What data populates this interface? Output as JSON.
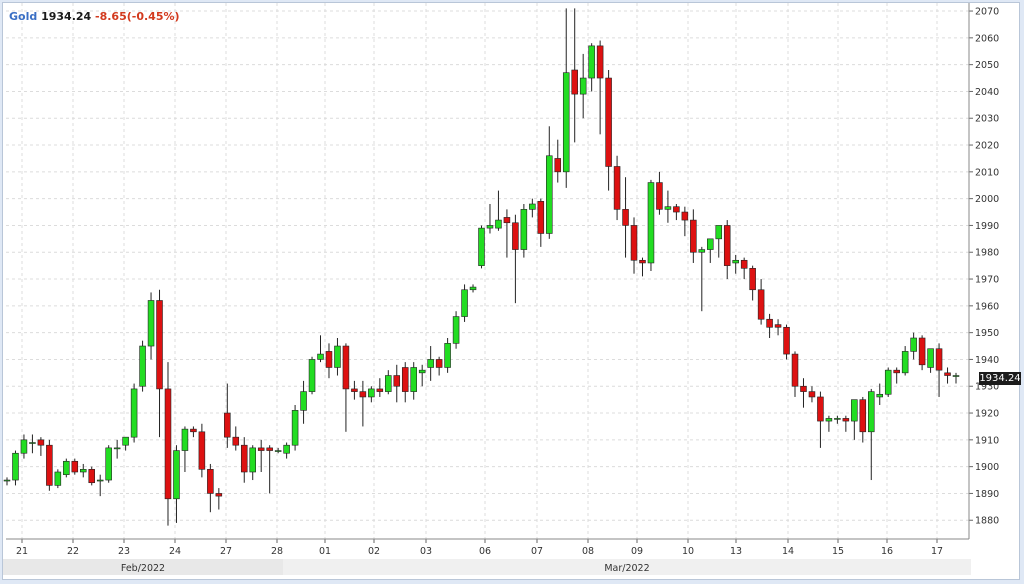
{
  "header": {
    "symbol": "Gold",
    "price": "1934.24",
    "change": "-8.65(-0.45%)"
  },
  "colors": {
    "up": "#22dd22",
    "down": "#dd1111",
    "grid": "#dcdcdc",
    "axis_text": "#333333",
    "background": "#ffffff"
  },
  "chart_data": {
    "type": "candlestick",
    "title": "",
    "xlabel": "",
    "ylabel": "",
    "ylim": [
      1873,
      2073
    ],
    "y_ticks": [
      1880,
      1890,
      1900,
      1910,
      1920,
      1930,
      1940,
      1950,
      1960,
      1970,
      1980,
      1990,
      2000,
      2010,
      2020,
      2030,
      2040,
      2050,
      2060,
      2070
    ],
    "last_price_label": "1934.24",
    "day_labels": [
      "21",
      "22",
      "23",
      "24",
      "27",
      "28",
      "01",
      "02",
      "03",
      "06",
      "07",
      "08",
      "09",
      "10",
      "13",
      "14",
      "15",
      "16",
      "17"
    ],
    "month_labels": [
      "Feb/2022",
      "Mar/2022"
    ],
    "candles": [
      [
        1895,
        1896,
        1893,
        1895
      ],
      [
        1895,
        1906,
        1893,
        1905
      ],
      [
        1905,
        1912,
        1903,
        1910
      ],
      [
        1909,
        1912,
        1905,
        1909
      ],
      [
        1910,
        1911,
        1904,
        1908
      ],
      [
        1908,
        1910,
        1891,
        1893
      ],
      [
        1893,
        1899,
        1892,
        1898
      ],
      [
        1897,
        1903,
        1896,
        1902
      ],
      [
        1902,
        1903,
        1897,
        1898
      ],
      [
        1898,
        1901,
        1896,
        1899
      ],
      [
        1899,
        1900,
        1893,
        1894
      ],
      [
        1895,
        1897,
        1889,
        1895
      ],
      [
        1895,
        1908,
        1894,
        1907
      ],
      [
        1907,
        1910,
        1903,
        1907
      ],
      [
        1908,
        1911,
        1906,
        1911
      ],
      [
        1911,
        1931,
        1909,
        1929
      ],
      [
        1930,
        1947,
        1928,
        1945
      ],
      [
        1945,
        1965,
        1940,
        1962
      ],
      [
        1962,
        1966,
        1911,
        1929
      ],
      [
        1929,
        1939,
        1878,
        1888
      ],
      [
        1888,
        1908,
        1879,
        1906
      ],
      [
        1906,
        1915,
        1898,
        1914
      ],
      [
        1914,
        1915,
        1911,
        1913
      ],
      [
        1913,
        1916,
        1896,
        1899
      ],
      [
        1899,
        1901,
        1883,
        1890
      ],
      [
        1890,
        1892,
        1884,
        1889
      ],
      [
        1920,
        1931,
        1907,
        1911
      ],
      [
        1911,
        1915,
        1906,
        1908
      ],
      [
        1908,
        1911,
        1894,
        1898
      ],
      [
        1898,
        1908,
        1895,
        1907
      ],
      [
        1907,
        1910,
        1898,
        1906
      ],
      [
        1907,
        1908,
        1890,
        1906
      ],
      [
        1906,
        1907,
        1905,
        1906
      ],
      [
        1905,
        1909,
        1903,
        1908
      ],
      [
        1908,
        1923,
        1906,
        1921
      ],
      [
        1921,
        1932,
        1916,
        1928
      ],
      [
        1928,
        1941,
        1927,
        1940
      ],
      [
        1940,
        1949,
        1939,
        1942
      ],
      [
        1943,
        1946,
        1933,
        1937
      ],
      [
        1937,
        1948,
        1934,
        1945
      ],
      [
        1945,
        1946,
        1913,
        1929
      ],
      [
        1929,
        1932,
        1925,
        1928
      ],
      [
        1928,
        1932,
        1915,
        1926
      ],
      [
        1926,
        1930,
        1924,
        1929
      ],
      [
        1929,
        1933,
        1926,
        1928
      ],
      [
        1928,
        1936,
        1927,
        1934
      ],
      [
        1934,
        1938,
        1924,
        1930
      ],
      [
        1937,
        1939,
        1924,
        1928
      ],
      [
        1928,
        1939,
        1925,
        1937
      ],
      [
        1935,
        1938,
        1930,
        1936
      ],
      [
        1937,
        1945,
        1932,
        1940
      ],
      [
        1940,
        1941,
        1934,
        1937
      ],
      [
        1937,
        1948,
        1935,
        1946
      ],
      [
        1946,
        1958,
        1944,
        1956
      ],
      [
        1956,
        1968,
        1954,
        1966
      ],
      [
        1966,
        1968,
        1965,
        1967
      ],
      [
        1975,
        1990,
        1974,
        1989
      ],
      [
        1989,
        1998,
        1987,
        1990
      ],
      [
        1989,
        2003,
        1988,
        1992
      ],
      [
        1993,
        1996,
        1978,
        1991
      ],
      [
        1991,
        1994,
        1961,
        1981
      ],
      [
        1981,
        1998,
        1978,
        1996
      ],
      [
        1996,
        2000,
        1993,
        1998
      ],
      [
        1999,
        2000,
        1982,
        1987
      ],
      [
        1987,
        2027,
        1985,
        2016
      ],
      [
        2015,
        2022,
        2006,
        2010
      ],
      [
        2010,
        2071,
        2004,
        2047
      ],
      [
        2048,
        2071,
        2021,
        2039
      ],
      [
        2039,
        2054,
        2030,
        2045
      ],
      [
        2045,
        2058,
        2040,
        2057
      ],
      [
        2057,
        2059,
        2024,
        2045
      ],
      [
        2045,
        2048,
        2003,
        2012
      ],
      [
        2012,
        2016,
        1992,
        1996
      ],
      [
        1996,
        2008,
        1978,
        1990
      ],
      [
        1990,
        1993,
        1972,
        1977
      ],
      [
        1977,
        1978,
        1971,
        1976
      ],
      [
        1976,
        2007,
        1973,
        2006
      ],
      [
        2006,
        2010,
        1994,
        1996
      ],
      [
        1996,
        2003,
        1991,
        1997
      ],
      [
        1997,
        1998,
        1992,
        1995
      ],
      [
        1995,
        1997,
        1986,
        1992
      ],
      [
        1992,
        1996,
        1976,
        1980
      ],
      [
        1980,
        1982,
        1958,
        1981
      ],
      [
        1981,
        1984,
        1976,
        1985
      ],
      [
        1985,
        1990,
        1978,
        1990
      ],
      [
        1990,
        1992,
        1970,
        1975
      ],
      [
        1976,
        1979,
        1972,
        1977
      ],
      [
        1977,
        1978,
        1970,
        1974
      ],
      [
        1974,
        1975,
        1962,
        1966
      ],
      [
        1966,
        1970,
        1953,
        1955
      ],
      [
        1955,
        1957,
        1948,
        1952
      ],
      [
        1953,
        1955,
        1949,
        1952
      ],
      [
        1952,
        1953,
        1940,
        1942
      ],
      [
        1942,
        1943,
        1926,
        1930
      ],
      [
        1930,
        1933,
        1922,
        1928
      ],
      [
        1928,
        1930,
        1924,
        1926
      ],
      [
        1926,
        1928,
        1907,
        1917
      ],
      [
        1917,
        1919,
        1913,
        1918
      ],
      [
        1918,
        1919,
        1916,
        1918
      ],
      [
        1918,
        1919,
        1913,
        1917
      ],
      [
        1917,
        1922,
        1910,
        1925
      ],
      [
        1925,
        1926,
        1909,
        1913
      ],
      [
        1913,
        1929,
        1895,
        1928
      ],
      [
        1926,
        1931,
        1923,
        1927
      ],
      [
        1927,
        1937,
        1926,
        1936
      ],
      [
        1936,
        1937,
        1931,
        1935
      ],
      [
        1935,
        1945,
        1934,
        1943
      ],
      [
        1943,
        1950,
        1940,
        1948
      ],
      [
        1948,
        1949,
        1936,
        1938
      ],
      [
        1937,
        1944,
        1935,
        1944
      ],
      [
        1944,
        1946,
        1926,
        1936
      ],
      [
        1935,
        1937,
        1931,
        1934
      ],
      [
        1934,
        1935,
        1931,
        1934
      ]
    ]
  }
}
